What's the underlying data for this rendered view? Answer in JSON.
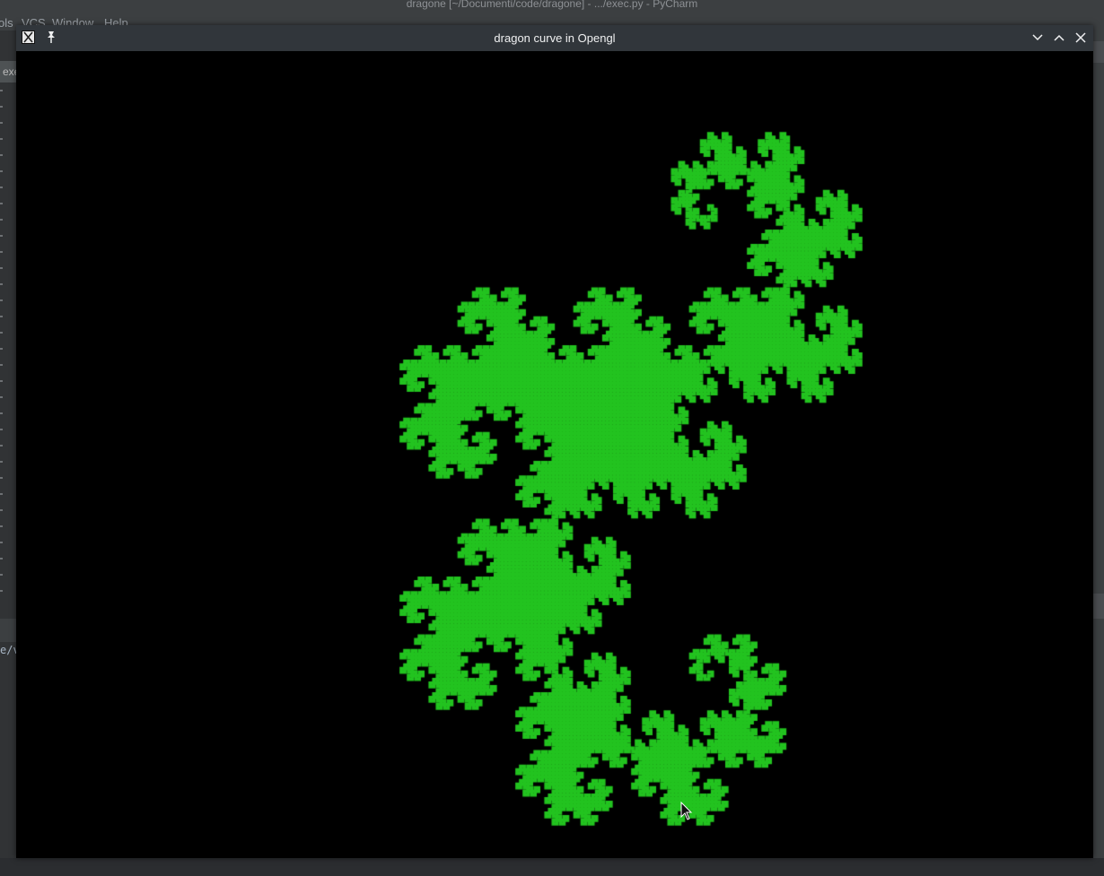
{
  "ide": {
    "title": "dragone [~/Documenti/code/dragone] - .../exec.py - PyCharm",
    "menu": [
      "ols",
      "VCS",
      "Window",
      "Help"
    ],
    "tab_label": "exec",
    "console_text": "e/v"
  },
  "gl_window": {
    "title": "dragon curve in Opengl",
    "controls": [
      "minimize-icon",
      "maximize-icon",
      "close-icon"
    ]
  },
  "colors": {
    "fractal_fill": "#22c31f",
    "canvas_bg": "#000000",
    "titlebar_bg": "#31363b"
  }
}
